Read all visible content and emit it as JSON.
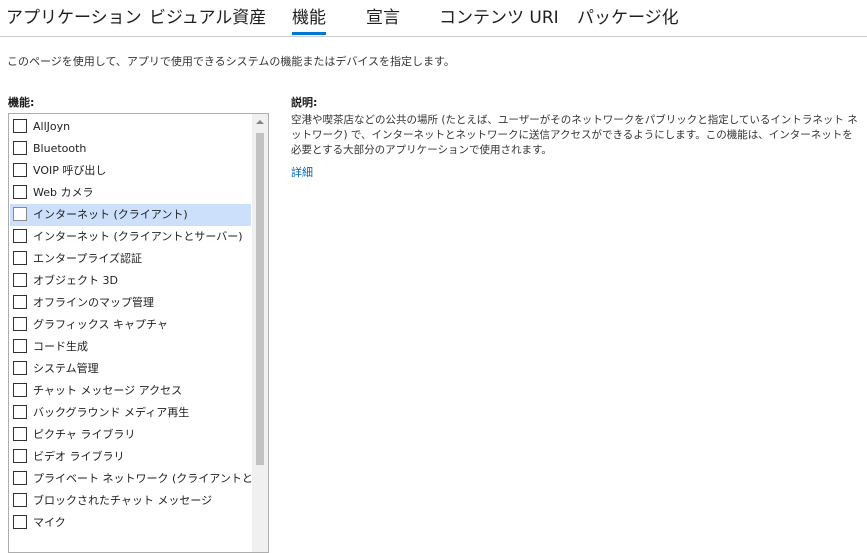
{
  "tabs": [
    {
      "label": "アプリケーション"
    },
    {
      "label": "ビジュアル資産"
    },
    {
      "label": "機能",
      "active": true
    },
    {
      "label": "宣言"
    },
    {
      "label": "コンテンツ URI"
    },
    {
      "label": "パッケージ化"
    }
  ],
  "intro": "このページを使用して、アプリで使用できるシステムの機能またはデバイスを指定します。",
  "capabilities": {
    "label": "機能:",
    "selected_index": 4,
    "items": [
      {
        "label": "AllJoyn",
        "checked": false
      },
      {
        "label": "Bluetooth",
        "checked": false
      },
      {
        "label": "VOIP 呼び出し",
        "checked": false
      },
      {
        "label": "Web カメラ",
        "checked": false
      },
      {
        "label": "インターネット (クライアント)",
        "checked": false
      },
      {
        "label": "インターネット (クライアントとサーバー)",
        "checked": false
      },
      {
        "label": "エンタープライズ認証",
        "checked": false
      },
      {
        "label": "オブジェクト 3D",
        "checked": false
      },
      {
        "label": "オフラインのマップ管理",
        "checked": false
      },
      {
        "label": "グラフィックス キャプチャ",
        "checked": false
      },
      {
        "label": "コード生成",
        "checked": false
      },
      {
        "label": "システム管理",
        "checked": false
      },
      {
        "label": "チャット メッセージ アクセス",
        "checked": false
      },
      {
        "label": "バックグラウンド メディア再生",
        "checked": false
      },
      {
        "label": "ピクチャ ライブラリ",
        "checked": false
      },
      {
        "label": "ビデオ ライブラリ",
        "checked": false
      },
      {
        "label": "プライベート ネットワーク (クライアントとサーバー)",
        "checked": false
      },
      {
        "label": "ブロックされたチャット メッセージ",
        "checked": false
      },
      {
        "label": "マイク",
        "checked": false
      }
    ]
  },
  "description": {
    "label": "説明:",
    "text": "空港や喫茶店などの公共の場所 (たとえば、ユーザーがそのネットワークをパブリックと指定しているイントラネット ネットワーク) で、インターネットとネットワークに送信アクセスができるようにします。この機能は、インターネットを必要とする大部分のアプリケーションで使用されます。",
    "more_link": "詳細"
  },
  "colors": {
    "accent": "#0078d4",
    "selection": "#cce0fc",
    "link": "#0066b8"
  }
}
